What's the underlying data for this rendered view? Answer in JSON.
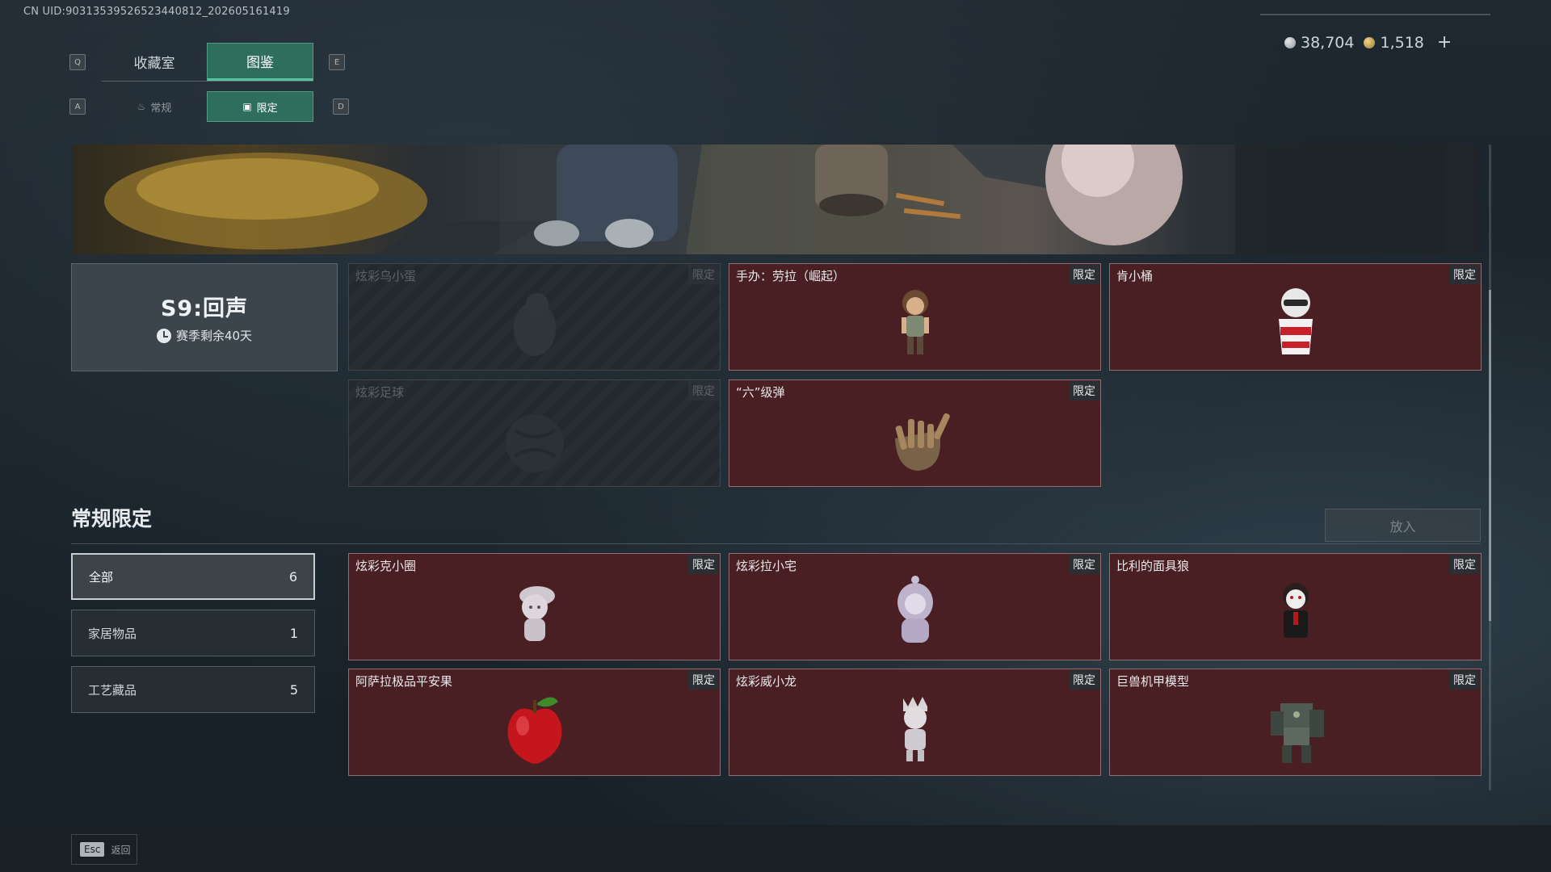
{
  "uid": "CN UID:9031353952652344081​2_202605161419",
  "currency": {
    "silver": "38,704",
    "gold": "1,518",
    "add_label": "+"
  },
  "keys": {
    "prev_tab": "Q",
    "next_tab": "E",
    "prev_sub": "A",
    "next_sub": "D"
  },
  "tabs": [
    {
      "label": "收藏室"
    },
    {
      "label": "图鉴"
    }
  ],
  "subtabs": [
    {
      "label": "常规"
    },
    {
      "label": "限定"
    }
  ],
  "season": {
    "name": "S9:回声",
    "remaining": "赛季剩余40天"
  },
  "season_cards": [
    {
      "name": "炫彩乌小蛋",
      "tag": "限定",
      "locked": true
    },
    {
      "name": "手办：劳拉（崛起）",
      "tag": "限定",
      "locked": false
    },
    {
      "name": "肯小桶",
      "tag": "限定",
      "locked": false
    },
    {
      "name": "炫彩足球",
      "tag": "限定",
      "locked": true
    },
    {
      "name": "“六”级弹",
      "tag": "限定",
      "locked": false
    }
  ],
  "section": {
    "title": "常规限定",
    "put_label": "放入"
  },
  "filters": [
    {
      "label": "全部",
      "count": "6"
    },
    {
      "label": "家居物品",
      "count": "1"
    },
    {
      "label": "工艺藏品",
      "count": "5"
    }
  ],
  "items": [
    {
      "name": "炫彩克小圈",
      "tag": "限定"
    },
    {
      "name": "炫彩拉小宅",
      "tag": "限定"
    },
    {
      "name": "比利的面具狼",
      "tag": "限定"
    },
    {
      "name": "阿萨拉极品平安果",
      "tag": "限定"
    },
    {
      "name": "炫彩威小龙",
      "tag": "限定"
    },
    {
      "name": "巨兽机甲模型",
      "tag": "限定"
    }
  ],
  "footer": {
    "esc_key": "Esc",
    "back_label": "返回"
  }
}
